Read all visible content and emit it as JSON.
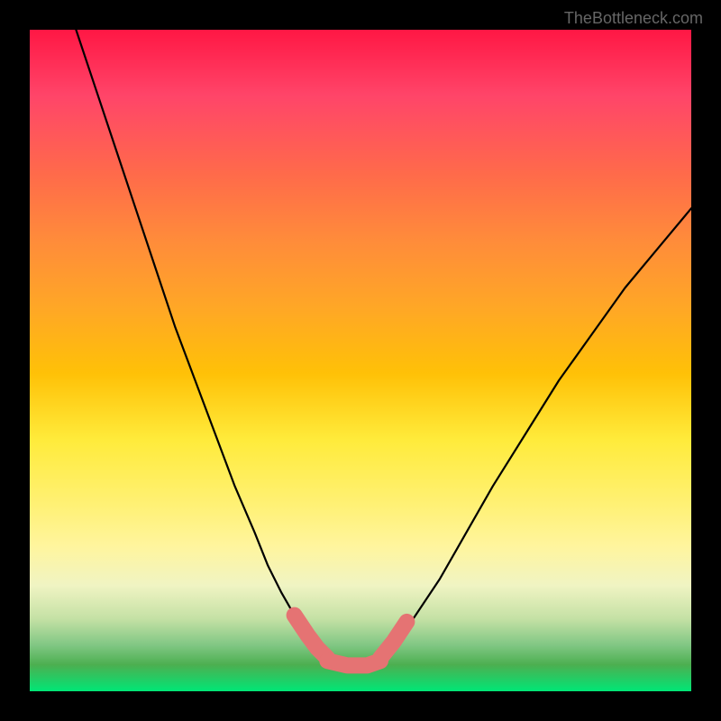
{
  "watermark": "TheBottleneck.com",
  "colors": {
    "curve": "#000000",
    "highlight": "#e57373"
  },
  "chart_data": {
    "type": "line",
    "title": "",
    "xlabel": "",
    "ylabel": "",
    "xlim": [
      0,
      100
    ],
    "ylim": [
      0,
      100
    ],
    "grid": false,
    "note": "Axes have no visible tick labels; values are in percentage of plot width/height. Y=0 at the bottom (green), Y=100 at the top (red).",
    "series": [
      {
        "name": "left-curve",
        "x": [
          7.0,
          10,
          13,
          16,
          19,
          22,
          25,
          28,
          31,
          34,
          36,
          38,
          40,
          42,
          43.5,
          45
        ],
        "y": [
          100,
          91,
          82,
          73,
          64,
          55,
          47,
          39,
          31,
          24,
          19,
          15,
          11.5,
          8.5,
          6.5,
          5.0
        ]
      },
      {
        "name": "right-curve",
        "x": [
          53,
          55,
          57,
          59,
          62,
          66,
          70,
          75,
          80,
          85,
          90,
          95,
          100
        ],
        "y": [
          5.0,
          7.0,
          9.5,
          12.5,
          17,
          24,
          31,
          39,
          47,
          54,
          61,
          67,
          73
        ]
      },
      {
        "name": "flat-bottom",
        "x": [
          45,
          48,
          51,
          53
        ],
        "y": [
          5.0,
          4.2,
          4.2,
          5.0
        ]
      }
    ],
    "highlights": [
      {
        "name": "left-highlight",
        "x": [
          40,
          42,
          43.5,
          45
        ],
        "y": [
          11.5,
          8.5,
          6.5,
          5.0
        ]
      },
      {
        "name": "bottom-highlight",
        "x": [
          45,
          48,
          51,
          53
        ],
        "y": [
          4.6,
          3.9,
          3.9,
          4.6
        ]
      },
      {
        "name": "right-highlight",
        "x": [
          53,
          55,
          57
        ],
        "y": [
          5.0,
          7.5,
          10.5
        ]
      }
    ]
  }
}
